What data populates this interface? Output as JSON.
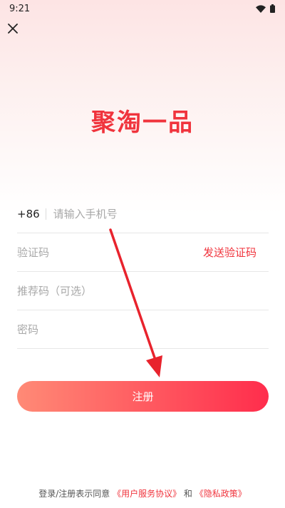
{
  "status_bar": {
    "time": "9:21"
  },
  "header": {
    "app_title": "聚淘一品"
  },
  "form": {
    "phone": {
      "prefix": "+86",
      "placeholder": "请输入手机号"
    },
    "code": {
      "placeholder": "验证码",
      "send_code_label": "发送验证码"
    },
    "referral": {
      "placeholder": "推荐码（可选）"
    },
    "password": {
      "placeholder": "密码"
    }
  },
  "register_button": {
    "label": "注册"
  },
  "agreement": {
    "prefix": "登录/注册表示同意",
    "user_agreement": "《用户服务协议》",
    "connector": "和",
    "privacy_policy": "《隐私政策》"
  },
  "colors": {
    "accent": "#f0343d",
    "button_gradient_start": "#ff8a76",
    "button_gradient_end": "#ff2d4c",
    "annotation_arrow": "#e8232d"
  },
  "icons": [
    "close-icon",
    "wifi-icon",
    "battery-icon",
    "annotation-arrow"
  ]
}
